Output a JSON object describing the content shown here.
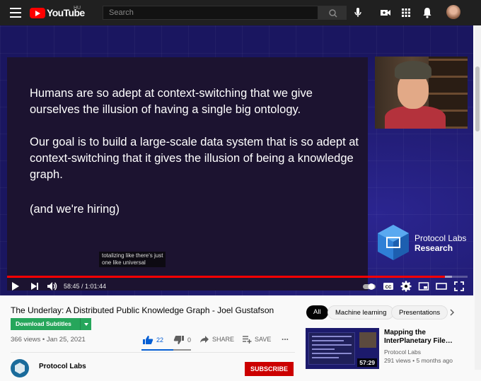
{
  "header": {
    "logo_text": "YouTube",
    "logo_region": "HU",
    "search_placeholder": "Search",
    "icons": [
      "menu-icon",
      "search-icon",
      "mic-icon",
      "create-video-icon",
      "apps-icon",
      "bell-icon",
      "avatar"
    ]
  },
  "video": {
    "slide_lines": [
      "Humans are so adept at context-switching that we give ourselves the illusion of having a single big ontology.",
      "Our goal is to build a large-scale data system that is so adept at context-switching that it gives the illusion of being a knowledge graph.",
      "(and we're hiring)"
    ],
    "brand_line1": "Protocol Labs",
    "brand_line2": "Research",
    "caption_line1": "totalizing like there's just",
    "caption_line2": "one like universal",
    "current_time": "58:45",
    "duration": "1:01:44",
    "time_display": "58:45 / 1:01:44",
    "progress_fraction": 0.951,
    "buffered_fraction": 0.967,
    "accent_color": "#ff0000"
  },
  "info": {
    "title": "The Underlay: A Distributed Public Knowledge Graph - Joel Gustafson",
    "download_label": "Download Subtitles",
    "views": "366 views",
    "date": "Jan 25, 2021",
    "meta_line": "366 views • Jan 25, 2021",
    "likes": "22",
    "dislikes": "0",
    "share_label": "SHARE",
    "save_label": "SAVE",
    "more_label": "...",
    "channel_name": "Protocol Labs",
    "subscribe_label": "SUBSCRIBE"
  },
  "chips": [
    {
      "label": "All",
      "active": true
    },
    {
      "label": "Machine learning",
      "active": false
    },
    {
      "label": "Presentations",
      "active": false
    }
  ],
  "recommendation": {
    "title": "Mapping the InterPlanetary File…",
    "channel": "Protocol Labs",
    "meta": "291 views • 5 months ago",
    "duration": "57:29"
  }
}
